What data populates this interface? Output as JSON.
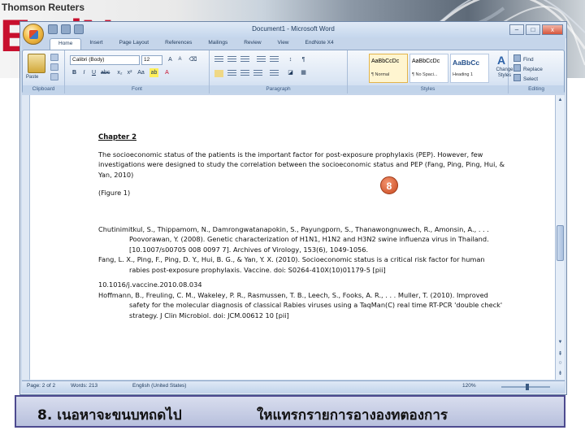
{
  "banner": {
    "brand": "Thomson Reuters",
    "logo_text": "EndNote"
  },
  "window": {
    "title": "Document1 - Microsoft Word",
    "controls": {
      "minimize": "–",
      "maximize": "□",
      "close": "x"
    }
  },
  "ribbon": {
    "tabs": [
      "Home",
      "Insert",
      "Page Layout",
      "References",
      "Mailings",
      "Review",
      "View",
      "EndNote X4"
    ],
    "active_tab": "Home",
    "clipboard": {
      "paste_label": "Paste",
      "group_label": "Clipboard"
    },
    "font": {
      "font_name": "Calibri (Body)",
      "font_size": "12",
      "group_label": "Font"
    },
    "paragraph": {
      "group_label": "Paragraph"
    },
    "styles": {
      "group_label": "Styles",
      "tiles": [
        {
          "sample": "AaBbCcDc",
          "name": "¶ Normal"
        },
        {
          "sample": "AaBbCcDc",
          "name": "¶ No Spaci..."
        },
        {
          "sample": "AaBbCc",
          "name": "Heading 1"
        }
      ],
      "change_styles": "Change Styles"
    },
    "editing": {
      "group_label": "Editing",
      "find": "Find",
      "replace": "Replace",
      "select": "Select"
    }
  },
  "document": {
    "chapter": "Chapter 2",
    "paragraph": "The socioeconomic status of the patients is the important factor for post-exposure prophylaxis (PEP). However, few investigations were designed to study the correlation between the socioeconomic status and PEP (Fang, Ping, Ping, Hui, & Yan, 2010)",
    "figure": "(Figure 1)",
    "references": [
      "Chutinimitkul, S., Thippamom, N., Damrongwatanapokin, S., Payungporn, S., Thanawongnuwech, R., Amonsin, A., . . . Poovorawan, Y. (2008). Genetic characterization of H1N1, H1N2 and H3N2 swine influenza virus in Thailand. [10.1007/s00705 008 0097 7]. Archives of Virology, 153(6), 1049-1056.",
      "Fang, L. X., Ping, F., Ping, D. Y., Hui, B. G., & Yan, Y. X. (2010). Socioeconomic status is a critical risk factor for human rabies post-exposure prophylaxis. Vaccine. doi: S0264-410X(10)01179-5 [pii]",
      "10.1016/j.vaccine.2010.08.034",
      "Hoffmann, B., Freuling, C. M., Wakeley, P. R., Rasmussen, T. B., Leech, S., Fooks, A. R., . . . Muller, T. (2010). Improved safety for the molecular diagnosis of classical Rabies viruses using a TaqMan(C) real time RT-PCR 'double check' strategy. J Clin Microbiol. doi: JCM.00612 10 [pii]"
    ],
    "step_badge": "8"
  },
  "statusbar": {
    "page": "Page: 2 of 2",
    "words": "Words: 213",
    "language": "English (United States)",
    "zoom": "120%"
  },
  "caption": {
    "left": "8. เนอหาจะขนบทถดไป",
    "right": "ใหแทรกรายการอางองทตองการ"
  }
}
